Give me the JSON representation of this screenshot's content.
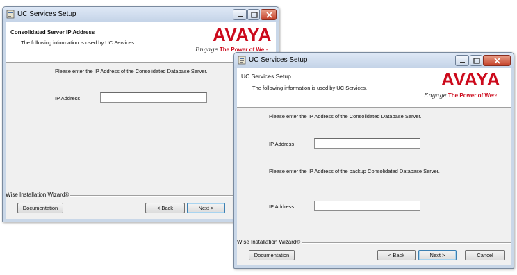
{
  "window1": {
    "title": "UC Services Setup",
    "banner_title": "Consolidated Server IP Address",
    "banner_subtitle": "The following information is used by UC Services.",
    "logo": "AVAYA",
    "tagline_script": "Engage",
    "tagline_text": "The Power of We",
    "tagline_mark": "™",
    "prompt": "Please enter the IP Address of the Consolidated Database Server.",
    "ip_label": "IP Address",
    "ip_value": "",
    "wizard_label": "Wise Installation Wizard®",
    "documentation_button": "Documentation",
    "back_button": "< Back",
    "next_button": "Next >"
  },
  "window2": {
    "title": "UC Services Setup",
    "banner_title": "UC Services Setup",
    "banner_subtitle": "The following information is used by UC Services.",
    "logo": "AVAYA",
    "tagline_script": "Engage",
    "tagline_text": "The Power of We",
    "tagline_mark": "™",
    "prompt1": "Please enter the IP Address of the Consolidated Database Server.",
    "ip_label1": "IP Address",
    "ip_value1": "",
    "prompt2": "Please enter the IP Address of the backup Consolidated Database Server.",
    "ip_label2": "IP Address",
    "ip_value2": "",
    "wizard_label": "Wise Installation Wizard®",
    "documentation_button": "Documentation",
    "back_button": "< Back",
    "next_button": "Next >",
    "cancel_button": "Cancel"
  },
  "icons": [
    "setup-app-icon",
    "minimize-icon",
    "maximize-icon",
    "close-icon"
  ],
  "colors": {
    "brand_red": "#cc0a1c",
    "titlebar": "#c9d7e8",
    "close": "#c4412a"
  }
}
